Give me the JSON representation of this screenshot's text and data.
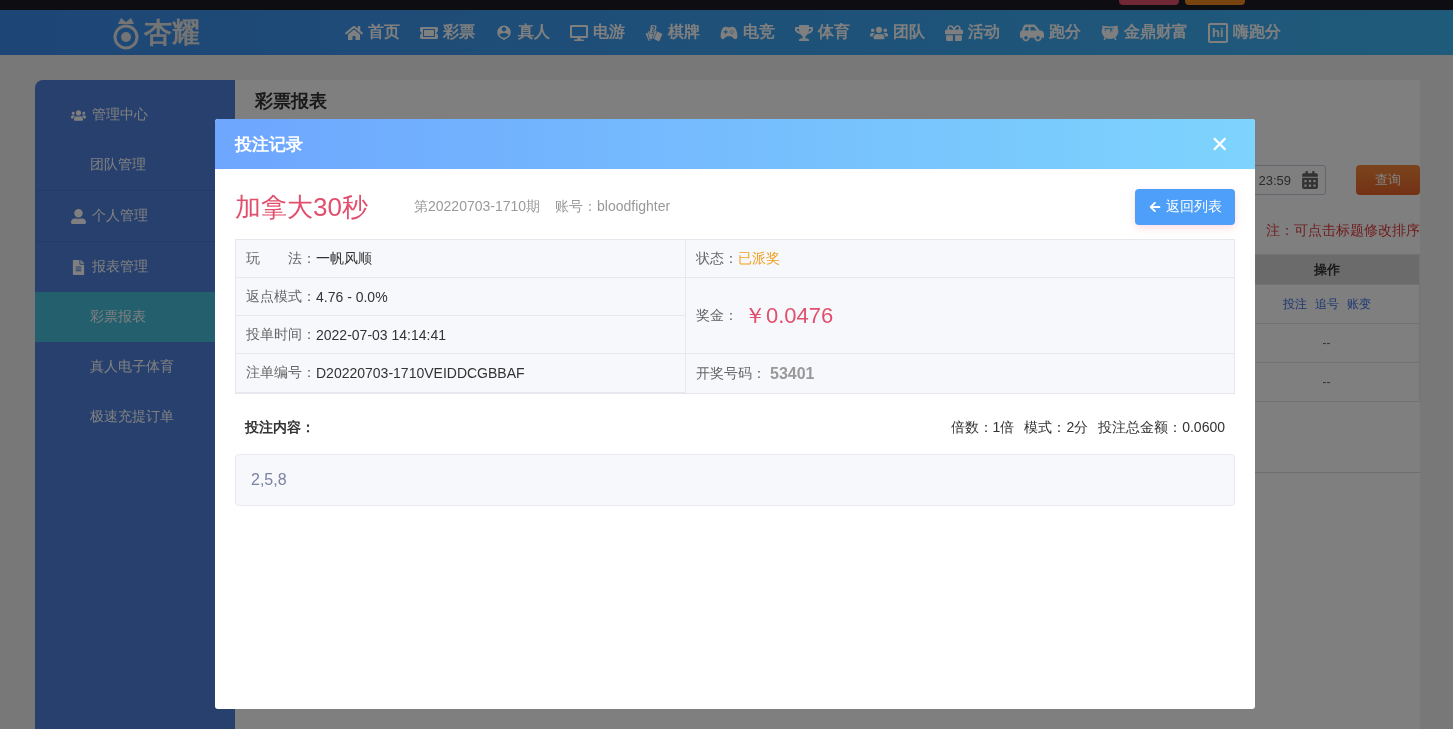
{
  "header": {
    "logo": "杏耀",
    "nav": [
      {
        "label": "首页"
      },
      {
        "label": "彩票"
      },
      {
        "label": "真人"
      },
      {
        "label": "电游"
      },
      {
        "label": "棋牌"
      },
      {
        "label": "电竞"
      },
      {
        "label": "体育"
      },
      {
        "label": "团队"
      },
      {
        "label": "活动"
      },
      {
        "label": "跑分"
      },
      {
        "label": "金鼎财富"
      },
      {
        "label": "嗨跑分",
        "icon_text": "hi"
      }
    ]
  },
  "sidebar": {
    "sections": [
      {
        "label": "管理中心",
        "children": [
          {
            "label": "团队管理",
            "selected": false
          }
        ]
      },
      {
        "label": "个人管理"
      },
      {
        "label": "报表管理",
        "children": [
          {
            "label": "彩票报表",
            "selected": true
          },
          {
            "label": "真人电子体育",
            "selected": false
          },
          {
            "label": "极速充提订单",
            "selected": false
          }
        ]
      }
    ]
  },
  "report": {
    "title": "彩票报表",
    "date_value": "23:59",
    "query_button": "查询",
    "note": "注：可点击标题修改排序",
    "table": {
      "columns": [
        "操作"
      ],
      "rows": [
        {
          "links": [
            "投注",
            "追号",
            "账变"
          ]
        },
        {
          "text": "--"
        },
        {
          "text": "--"
        }
      ]
    }
  },
  "modal": {
    "title": "投注记录",
    "close": "✕",
    "game": "加拿大30秒",
    "period": "第20220703-1710期",
    "account_label": "账号：",
    "account": "bloodfighter",
    "back_button": "返回列表",
    "details": [
      {
        "label": "玩　　法：",
        "value": "一帆风顺",
        "kind": "plain"
      },
      {
        "label": "状态：",
        "value": "已派奖",
        "kind": "status"
      },
      {
        "label": "返点模式：",
        "value": "4.76 - 0.0%",
        "kind": "plain"
      },
      {
        "label": "奖金：",
        "value": "￥0.0476",
        "kind": "prize"
      },
      {
        "label": "投单时间：",
        "value": "2022-07-03 14:14:41",
        "kind": "plain"
      },
      {
        "label": "注单编号：",
        "value": "D20220703-1710VEIDDCGBBAF",
        "kind": "plain"
      },
      {
        "label": "开奖号码：",
        "value": "53401",
        "kind": "draw"
      }
    ],
    "content_label": "投注内容：",
    "summary": [
      {
        "label": "倍数：",
        "value": "1倍"
      },
      {
        "label": "模式：",
        "value": "2分"
      },
      {
        "label": "投注总金额：",
        "value": "0.0600"
      }
    ],
    "content": "2,5,8"
  }
}
